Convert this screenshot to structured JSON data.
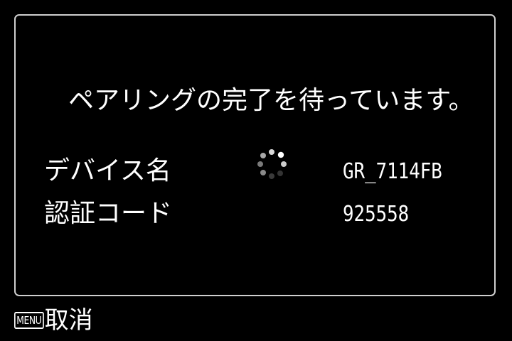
{
  "dialog": {
    "message": "ペアリングの完了を待っています。",
    "rows": [
      {
        "label": "デバイス名",
        "value": "GR_7114FB"
      },
      {
        "label": "認証コード",
        "value": "925558"
      }
    ]
  },
  "footer": {
    "menu_key": "MENU",
    "cancel_label": "取消"
  },
  "colors": {
    "background": "#000000",
    "text": "#ffffff",
    "border": "#cfcfcf"
  },
  "icons": {
    "spinner": "loading-spinner-icon"
  }
}
